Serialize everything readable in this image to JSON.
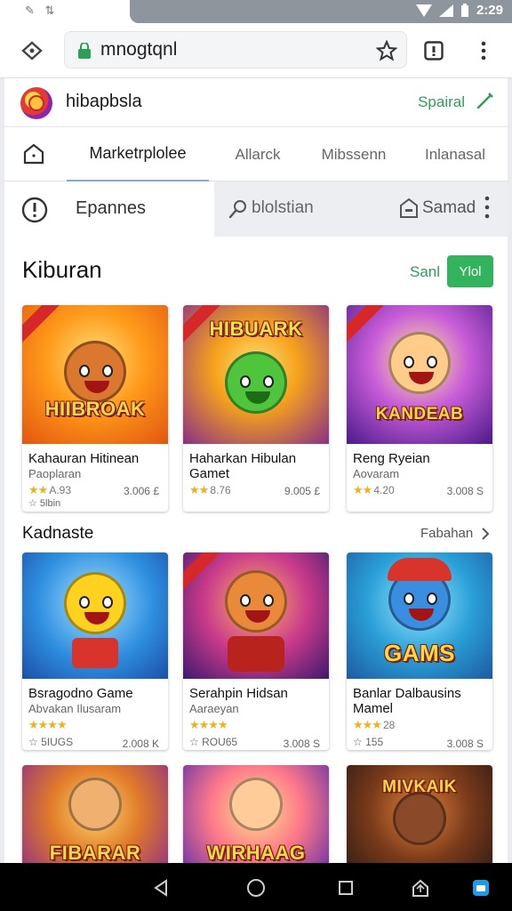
{
  "status_bar": {
    "left_icons": "✎ ⇅",
    "time": "2:29"
  },
  "browser": {
    "url": "mnogtqnl"
  },
  "app": {
    "title": "hibapbsla",
    "header_link": "Spairal"
  },
  "tabs": [
    {
      "label": "Marketrplolee"
    },
    {
      "label": "Allarck"
    },
    {
      "label": "Mibssenn"
    },
    {
      "label": "Inlanasal"
    }
  ],
  "filter": {
    "label": "Epannes",
    "search_placeholder": "blolstian",
    "save_label": "Samad"
  },
  "section1": {
    "title": "Kiburan",
    "see_all": "Sanl",
    "button": "Ylol"
  },
  "section2": {
    "title": "Kadnaste",
    "more": "Fabahan"
  },
  "games_row1": [
    {
      "name": "Kahauran Hitinean",
      "sub": "Paoplaran",
      "stars": "★★",
      "rating": "A.93",
      "extra": "☆ 5lbin",
      "price": "3.006 £",
      "thumb_title": "HIIBROAK"
    },
    {
      "name": "Haharkan Hibulan",
      "sub": "Gamet",
      "stars": "★★",
      "rating": "8.76",
      "extra": "",
      "price": "9.005 £",
      "thumb_title": "HIBUARK"
    },
    {
      "name": "Reng Ryeian",
      "sub": "Aovaram",
      "stars": "★★",
      "rating": "4.20",
      "extra": "",
      "price": "3.008 S",
      "thumb_title": "KANDEAB"
    }
  ],
  "games_row2": [
    {
      "name": "Bsragodno Game",
      "sub": "Abvakan Ilusaram",
      "stars": "★★★★",
      "rating": "",
      "extra": "☆ 5IUGS",
      "price": "2.008 K",
      "thumb_title": ""
    },
    {
      "name": "Serahpin Hidsan",
      "sub": "Aaraeyan",
      "stars": "★★★★",
      "rating": "",
      "extra": "☆ ROU65",
      "price": "3.008 S",
      "thumb_title": ""
    },
    {
      "name": "Banlar Dalbausins",
      "sub": "Mamel",
      "stars": "★★★",
      "rating": "28",
      "extra": "☆ 155",
      "price": "3.008 S",
      "thumb_title": "GAMS"
    }
  ],
  "games_row3": [
    {
      "thumb_title": "FIBARAR"
    },
    {
      "thumb_title": "WIRHAAG"
    },
    {
      "thumb_title": "MIVKAIK"
    }
  ],
  "colors": {
    "accent_green": "#33b35b",
    "tab_indicator": "#8ba9c8",
    "star": "#f2b01e"
  }
}
